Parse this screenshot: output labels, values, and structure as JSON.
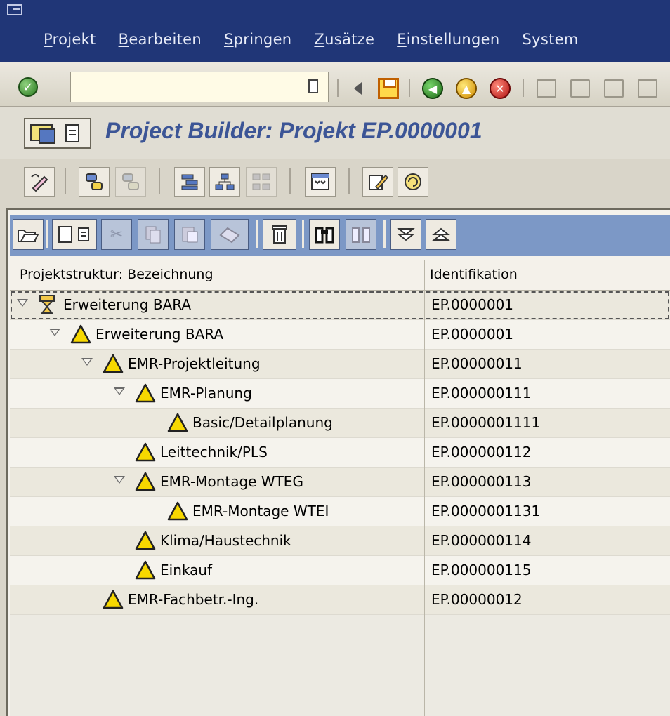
{
  "menu": {
    "items": [
      {
        "accel": "P",
        "rest": "rojekt"
      },
      {
        "accel": "B",
        "rest": "earbeiten"
      },
      {
        "accel": "S",
        "rest": "pringen"
      },
      {
        "accel": "Z",
        "rest": "usätze"
      },
      {
        "accel": "E",
        "rest": "instellungen"
      },
      {
        "accel": "",
        "rest": "System"
      }
    ]
  },
  "toolbar": {
    "command_value": "",
    "icons": [
      "enter-icon",
      "back-triangle-icon",
      "save-icon",
      "back-icon",
      "exit-icon",
      "cancel-icon",
      "print-icon",
      "find-icon",
      "find-next-icon"
    ]
  },
  "title": {
    "text": "Project Builder: Projekt EP.0000001"
  },
  "app_toolbar": {
    "icons": [
      "change-display-icon",
      "worklist-icon",
      "templates-icon",
      "structure-icon",
      "hierarchy-icon",
      "network-icon",
      "overview-icon",
      "edit-icon",
      "refresh-icon"
    ]
  },
  "tree_toolbar": {
    "icons": [
      "open-icon",
      "new-icon",
      "cut-icon",
      "copy-icon",
      "paste-icon",
      "undo-icon",
      "delete-icon",
      "find-icon",
      "find-next-icon",
      "expand-icon",
      "collapse-icon"
    ]
  },
  "table": {
    "headers": [
      "Projektstruktur: Bezeichnung",
      "Identifikation"
    ],
    "rows": [
      {
        "level": 0,
        "expanded": true,
        "icon": "project-definition-icon",
        "label": "Erweiterung BARA",
        "id": "EP.0000001"
      },
      {
        "level": 1,
        "expanded": true,
        "icon": "warning-icon",
        "label": "Erweiterung BARA",
        "id": "EP.0000001"
      },
      {
        "level": 2,
        "expanded": true,
        "icon": "warning-icon",
        "label": "EMR-Projektleitung",
        "id": "EP.00000011"
      },
      {
        "level": 3,
        "expanded": true,
        "icon": "warning-icon",
        "label": "EMR-Planung",
        "id": "EP.000000111"
      },
      {
        "level": 4,
        "expanded": false,
        "icon": "warning-icon",
        "label": "Basic/Detailplanung",
        "id": "EP.0000001111"
      },
      {
        "level": 3,
        "expanded": false,
        "icon": "warning-icon",
        "label": "Leittechnik/PLS",
        "id": "EP.000000112"
      },
      {
        "level": 3,
        "expanded": true,
        "icon": "warning-icon",
        "label": "EMR-Montage WTEG",
        "id": "EP.000000113"
      },
      {
        "level": 4,
        "expanded": false,
        "icon": "warning-icon",
        "label": "EMR-Montage WTEI",
        "id": "EP.0000001131"
      },
      {
        "level": 3,
        "expanded": false,
        "icon": "warning-icon",
        "label": "Klima/Haustechnik",
        "id": "EP.000000114"
      },
      {
        "level": 3,
        "expanded": false,
        "icon": "warning-icon",
        "label": "Einkauf",
        "id": "EP.000000115"
      },
      {
        "level": 2,
        "expanded": false,
        "icon": "warning-icon",
        "label": "EMR-Fachbetr.-Ing.",
        "id": "EP.00000012"
      }
    ]
  }
}
